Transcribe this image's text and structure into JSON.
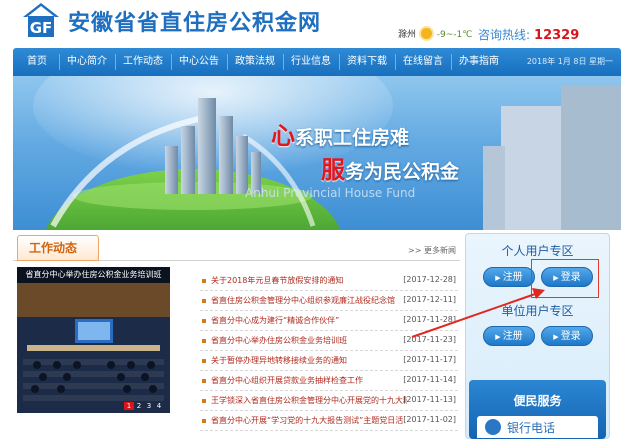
{
  "header": {
    "site_title": "安徽省省直住房公积金网",
    "weather_city": "滁州",
    "weather_temp": "-9~-1℃",
    "hotline_label": "咨询热线:",
    "hotline_number": "12329"
  },
  "nav": {
    "items": [
      "首页",
      "中心简介",
      "工作动态",
      "中心公告",
      "政策法规",
      "行业信息",
      "资料下载",
      "在线留言",
      "办事指南"
    ],
    "date": "2018年 1月 8日 星期一"
  },
  "banner": {
    "slogan1_big": "心",
    "slogan1_rest": "系职工住房难",
    "slogan2_big": "服",
    "slogan2_rest": "务为民公积金",
    "english": "Anhui Provincial House Fund"
  },
  "news": {
    "title": "工作动态",
    "more": "更多新闻",
    "photo_caption": "省直分中心举办住房公积金业务培训班",
    "photo_pages": [
      "1",
      "2",
      "3",
      "4"
    ],
    "items": [
      {
        "text": "关于2018年元旦春节放假安排的通知",
        "date": "[2017-12-28]"
      },
      {
        "text": "省直住房公积金管理分中心组织参观廉江战役纪念馆",
        "date": "[2017-12-11]"
      },
      {
        "text": "省直分中心成为建行“精诚合作伙伴”",
        "date": "[2017-11-28]"
      },
      {
        "text": "省直分中心举办住房公积金业务培训班",
        "date": "[2017-11-23]"
      },
      {
        "text": "关于暂停办理异地转移接续业务的通知",
        "date": "[2017-11-17]"
      },
      {
        "text": "省直分中心组织开展贷款业务抽样检查工作",
        "date": "[2017-11-14]"
      },
      {
        "text": "王学锁深入省直住房公积金管理分中心开展党的十九大精",
        "date": "[2017-11-13]"
      },
      {
        "text": "省直分中心开展“学习党的十九大报告测试”主题党日活",
        "date": "[2017-11-02]"
      }
    ]
  },
  "side": {
    "personal_title": "个人用户专区",
    "unit_title": "单位用户专区",
    "register_label": "注册",
    "login_label": "登录",
    "service_title": "便民服务",
    "bank_phone": "银行电话"
  }
}
